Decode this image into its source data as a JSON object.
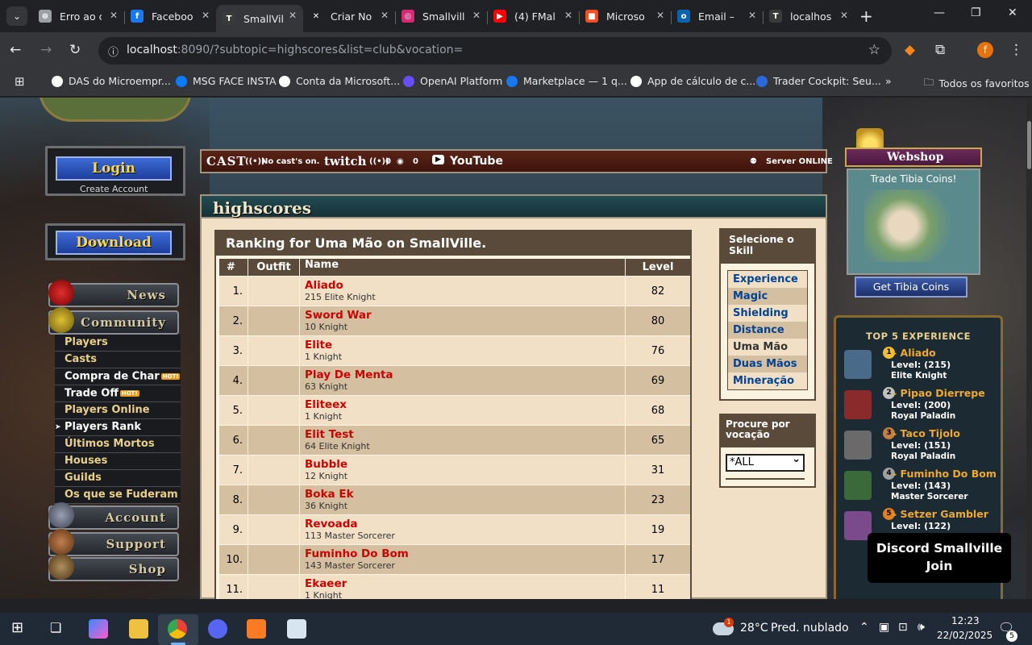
{
  "browser": {
    "tabs": [
      {
        "title": "Erro ao c",
        "fav_color": "#9aa0a6",
        "fav_glyph": "⊛"
      },
      {
        "title": "Faceboo",
        "fav_color": "#1877f2",
        "fav_glyph": "f"
      },
      {
        "title": "SmallVil",
        "fav_color": "#3a3a3a",
        "fav_glyph": "T",
        "active": true
      },
      {
        "title": "Criar No",
        "fav_color": "#202124",
        "fav_glyph": "✕"
      },
      {
        "title": "Smallvill",
        "fav_color": "#d62976",
        "fav_glyph": "◎"
      },
      {
        "title": "(4) FMal",
        "fav_color": "#ff0000",
        "fav_glyph": "▶"
      },
      {
        "title": "Microso",
        "fav_color": "#f25022",
        "fav_glyph": "■"
      },
      {
        "title": "Email –",
        "fav_color": "#0a64ad",
        "fav_glyph": "o"
      },
      {
        "title": "localhos",
        "fav_color": "#3a3a3a",
        "fav_glyph": "T"
      }
    ],
    "url_host": "localhost",
    "url_rest": ":8090/?subtopic=highscores&list=club&vocation=",
    "profile_initial": "f",
    "bookmarks": [
      {
        "label": "DAS do Microempr...",
        "color": "#ffffff"
      },
      {
        "label": "MSG FACE INSTA",
        "color": "#0a7cff"
      },
      {
        "label": "Conta da Microsoft...",
        "color": "#ffffff"
      },
      {
        "label": "OpenAI Platform",
        "color": "#6a4cff"
      },
      {
        "label": "Marketplace — 1 q...",
        "color": "#1877f2"
      },
      {
        "label": "App de cálculo de c...",
        "color": "#ffffff"
      },
      {
        "label": "Trader Cockpit: Seu...",
        "color": "#2a6ad8"
      }
    ],
    "bookmarks_more": "»",
    "all_favorites": "Todos os favoritos"
  },
  "site": {
    "login_label": "Login",
    "create_account": "Create Account",
    "download_label": "Download",
    "menu": {
      "news": "News",
      "community": "Community",
      "account": "Account",
      "support": "Support",
      "shop": "Shop"
    },
    "community_items": [
      {
        "label": "Players",
        "white": false
      },
      {
        "label": "Casts",
        "white": false
      },
      {
        "label": "Compra de Char",
        "white": true,
        "hot": "HOT!"
      },
      {
        "label": "Trade Off",
        "white": true,
        "hot": "HOT!"
      },
      {
        "label": "Players Online",
        "white": false
      },
      {
        "label": "Players Rank",
        "white": true,
        "current": true
      },
      {
        "label": "Últimos Mortos",
        "white": false
      },
      {
        "label": "Houses",
        "white": false
      },
      {
        "label": "Guilds",
        "white": false
      },
      {
        "label": "Os que se Fuderam",
        "white": false
      }
    ],
    "stream_bar": {
      "cast_logo": "CAST",
      "no_casts": "No cast's on.",
      "twitch_logo": "twitch",
      "twitch_live": "0",
      "twitch_viewers": "0",
      "youtube_logo": "YouTube",
      "server_status": "Server ONLINE"
    },
    "highscores_title": "highscores",
    "ranking_title": "Ranking for Uma Mão on SmallVille.",
    "table_headers": {
      "num": "#",
      "outfit": "Outfit",
      "name": "Name",
      "level": "Level"
    },
    "rows": [
      {
        "num": "1.",
        "name": "Aliado",
        "vocation": "215 Elite Knight",
        "level": "82"
      },
      {
        "num": "2.",
        "name": "Sword War",
        "vocation": "10 Knight",
        "level": "80"
      },
      {
        "num": "3.",
        "name": "Elite",
        "vocation": "1 Knight",
        "level": "76"
      },
      {
        "num": "4.",
        "name": "Play De Menta",
        "vocation": "63 Knight",
        "level": "69"
      },
      {
        "num": "5.",
        "name": "Eliteex",
        "vocation": "1 Knight",
        "level": "68"
      },
      {
        "num": "6.",
        "name": "Elit Test",
        "vocation": "64 Elite Knight",
        "level": "65"
      },
      {
        "num": "7.",
        "name": "Bubble",
        "vocation": "12 Knight",
        "level": "31"
      },
      {
        "num": "8.",
        "name": "Boka Ek",
        "vocation": "36 Knight",
        "level": "23"
      },
      {
        "num": "9.",
        "name": "Revoada",
        "vocation": "113 Master Sorcerer",
        "level": "19"
      },
      {
        "num": "10.",
        "name": "Fuminho Do Bom",
        "vocation": "143 Master Sorcerer",
        "level": "17"
      },
      {
        "num": "11.",
        "name": "Ekaeer",
        "vocation": "1 Knight",
        "level": "11"
      }
    ],
    "skill_title": "Selecione o Skill",
    "skills": [
      {
        "label": "Experience"
      },
      {
        "label": "Magic"
      },
      {
        "label": "Shielding"
      },
      {
        "label": "Distance"
      },
      {
        "label": "Uma Mão",
        "selected": true
      },
      {
        "label": "Duas Mãos"
      },
      {
        "label": "Mineração"
      }
    ],
    "vocation_title": "Procure por vocação",
    "vocation_selected": "*ALL",
    "webshop_title": "Webshop",
    "webshop_banner": "Trade Tibia Coins!",
    "get_coins": "Get Tibia Coins",
    "top5_title": "TOP 5 EXPERIENCE",
    "top5": [
      {
        "medal": "1",
        "name": "- Aliado",
        "level": "Level: (215)",
        "vocation": "Elite Knight",
        "medal_color": "#f0c030",
        "avatar_color": "#4a6a8a"
      },
      {
        "medal": "2",
        "name": "- Pipao Dierrepe",
        "level": "Level: (200)",
        "vocation": "Royal Paladin",
        "medal_color": "#c0c0c0",
        "avatar_color": "#8a2a2a"
      },
      {
        "medal": "3",
        "name": "- Taco Tijolo",
        "level": "Level: (151)",
        "vocation": "Royal Paladin",
        "medal_color": "#c08040",
        "avatar_color": "#6a6a6a"
      },
      {
        "medal": "4",
        "name": "- Fuminho Do Bom",
        "level": "Level: (143)",
        "vocation": "Master Sorcerer",
        "medal_color": "#a0a0a0",
        "avatar_color": "#3a6a3a"
      },
      {
        "medal": "5",
        "name": "- Setzer Gambler",
        "level": "Level: (122)",
        "vocation": "",
        "medal_color": "#e08020",
        "avatar_color": "#7a4a8a"
      }
    ],
    "discord_line1": "Discord Smallville",
    "discord_line2": "Join"
  },
  "taskbar": {
    "weather_badge": "1",
    "temperature": "28°C",
    "weather_desc": "Pred. nublado",
    "time": "12:23",
    "date": "22/02/2025",
    "notification_count": "5"
  }
}
